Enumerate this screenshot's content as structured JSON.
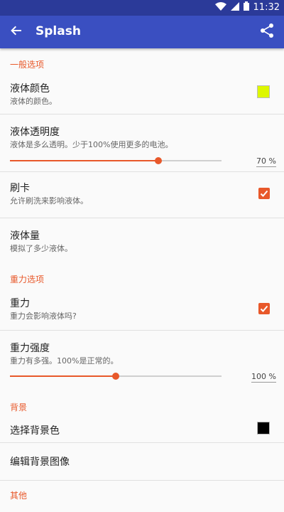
{
  "status_bar": {
    "time": "11:32"
  },
  "app_bar": {
    "title": "Splash"
  },
  "sections": {
    "general": "一般选项",
    "gravity": "重力选项",
    "background": "背景",
    "other": "其他"
  },
  "items": {
    "liquid_color": {
      "title": "液体颜色",
      "subtitle": "液体的颜色。",
      "swatch_color": "#ddf700"
    },
    "liquid_opacity": {
      "title": "液体透明度",
      "subtitle": "液体是多么透明。少于100%使用更多的电池。",
      "value_label": "70 %",
      "value": 0.7
    },
    "brush": {
      "title": "刷卡",
      "subtitle": "允许刷洗来影响液体。",
      "checked": true
    },
    "liquid_amount": {
      "title": "液体量",
      "subtitle": "模拟了多少液体。"
    },
    "gravity": {
      "title": "重力",
      "subtitle": "重力会影响液体吗?",
      "checked": true
    },
    "gravity_strength": {
      "title": "重力强度",
      "subtitle": "重力有多强。100%是正常的。",
      "value_label": "100 %",
      "value": 0.5
    },
    "bg_color": {
      "title": "选择背景色",
      "swatch_color": "#000000"
    },
    "bg_image": {
      "title": "编辑背景图像"
    }
  },
  "colors": {
    "accent": "#e8582a",
    "appbar": "#3a4fc1",
    "statusbar": "#2b3a99"
  }
}
